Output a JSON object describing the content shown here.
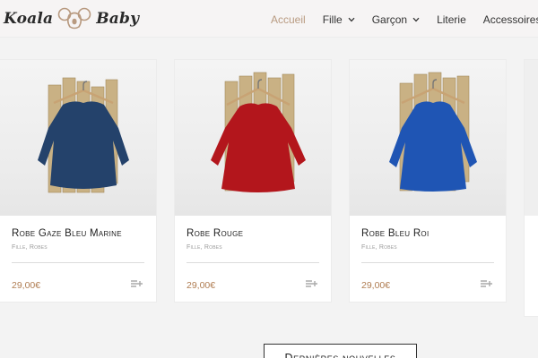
{
  "header": {
    "logo": {
      "word_left": "Koala",
      "word_right": "Baby"
    },
    "nav": [
      {
        "label": "Accueil",
        "active": true,
        "dropdown": false
      },
      {
        "label": "Fille",
        "active": false,
        "dropdown": true
      },
      {
        "label": "Garçon",
        "active": false,
        "dropdown": true
      },
      {
        "label": "Literie",
        "active": false,
        "dropdown": false
      },
      {
        "label": "Accessoires",
        "active": false,
        "dropdown": false
      }
    ]
  },
  "products": [
    {
      "name": "Robe Gaze Bleu Marine",
      "category_1": "Fille",
      "category_sep": ",",
      "category_2": "Robes",
      "price": "29,00€",
      "dress_color": "#24426b"
    },
    {
      "name": "Robe Rouge",
      "category_1": "Fille",
      "category_sep": ",",
      "category_2": "Robes",
      "price": "29,00€",
      "dress_color": "#b3161c"
    },
    {
      "name": "Robe Bleu Roi",
      "category_1": "Fille",
      "category_sep": ",",
      "category_2": "Robes",
      "price": "29,00€",
      "dress_color": "#1f55b4"
    }
  ],
  "cta": {
    "label": "Dernières nouvelles"
  },
  "colors": {
    "accent": "#b89a80",
    "price": "#b07d52"
  }
}
